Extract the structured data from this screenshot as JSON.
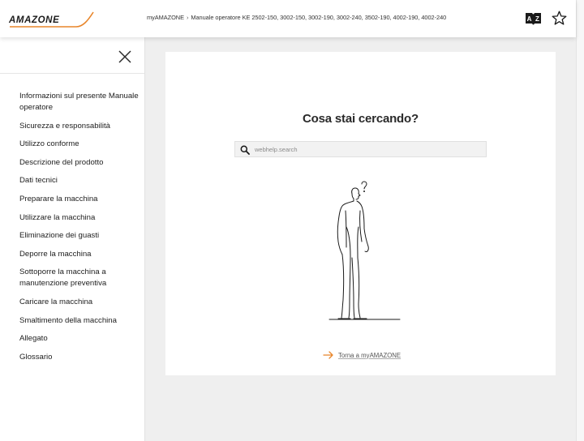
{
  "header": {
    "logo_text": "AMAZONE",
    "breadcrumb": {
      "home": "myAMAZONE",
      "separator": "›",
      "current": "Manuale operatore KE 2502-150, 3002-150, 3002-190, 3002-240, 3502-190, 4002-190, 4002-240"
    },
    "icons": [
      "glossary-az-icon",
      "favorite-star-icon"
    ]
  },
  "sidebar": {
    "close_icon": "close-icon",
    "items": [
      "Informazioni sul presente Manuale operatore",
      "Sicurezza e responsabilità",
      "Utilizzo conforme",
      "Descrizione del prodotto",
      "Dati tecnici",
      "Preparare la macchina",
      "Utilizzare la macchina",
      "Eliminazione dei guasti",
      "Deporre la macchina",
      "Sottoporre la macchina a manutenzione preventiva",
      "Caricare la macchina",
      "Smaltimento della macchina",
      "Allegato",
      "Glossario"
    ]
  },
  "main": {
    "title": "Cosa stai cercando?",
    "search": {
      "placeholder": "webhelp.search",
      "value": ""
    },
    "back_link": "Torna a myAMAZONE"
  },
  "colors": {
    "accent": "#e8852a",
    "text": "#222222",
    "background": "#efefef"
  }
}
